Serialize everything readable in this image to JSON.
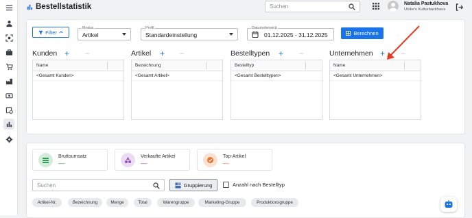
{
  "header": {
    "title": "Bestellstatistik",
    "search_placeholder": "Suchen",
    "user_name": "Natalia Pastukhova",
    "user_org": "Ulrike's Kulturbackhaus"
  },
  "filters": {
    "filter_label": "Filter",
    "modus_label": "Modus",
    "modus_value": "Artikel",
    "profil_label": "Profil",
    "profil_value": "Standardeinstellung",
    "datum_label": "Datumsbereich",
    "datum_value": "01.12.2025 - 31.12.2025",
    "calc_label": "Berechnen"
  },
  "dimensions": [
    {
      "title": "Kunden",
      "header": "Name",
      "row": "<Gesamt Kunden>"
    },
    {
      "title": "Artikel",
      "header": "Bezeichnung",
      "row": "<Gesamt Artikel>"
    },
    {
      "title": "Bestelltypen",
      "header": "Bestelltyp",
      "row": "<Gesamt Bestelltypen>"
    },
    {
      "title": "Unternehmen",
      "header": "Name",
      "row": "<Gesamt Unternehmen>"
    }
  ],
  "kpis": [
    {
      "label": "Bruttoumsatz",
      "value": "—",
      "color": "#2e9d57",
      "bg": "#d5ecdc"
    },
    {
      "label": "Verkaufte Artikel",
      "value": "—",
      "color": "#9b4fc4",
      "bg": "#e9dcf3"
    },
    {
      "label": "Top-Artikel",
      "value": "—",
      "color": "#e8722c",
      "bg": "#fbe1d0"
    }
  ],
  "results": {
    "search_placeholder": "Suchen",
    "group_label": "Gruppierung",
    "checkbox_label": "Anzahl nach Bestelltyp"
  },
  "chips": [
    "Artikel-Nr.",
    "Bezeichnung",
    "Menge",
    "Total",
    "Warengruppe",
    "Marketing-Gruppe",
    "Produktionsgruppe"
  ],
  "colors": {
    "accent": "#1a73e8",
    "annotation": "#e53a24"
  }
}
